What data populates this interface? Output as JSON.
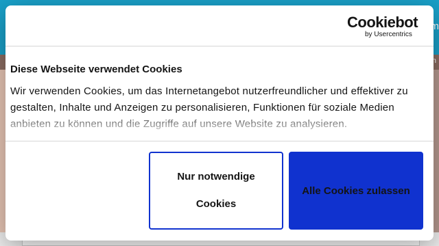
{
  "background": {
    "header_text": "m",
    "strip_text": "n"
  },
  "dialog": {
    "logo": {
      "main": "Cookiebot",
      "sub": "by Usercentrics"
    },
    "title": "Diese Webseite verwendet Cookies",
    "body": "Wir verwenden Cookies, um das Internetangebot nutzerfreundlicher und effektiver zu gestalten, Inhalte und Anzeigen zu personalisieren, Funktionen für soziale Medien anbieten zu können und die Zugriffe auf unsere Website zu analysieren.",
    "buttons": {
      "necessary": "Nur notwendige Cookies",
      "allow_all": "Alle Cookies zulassen"
    }
  },
  "colors": {
    "header_bg": "#1aa1c9",
    "accent": "#1032cf"
  }
}
